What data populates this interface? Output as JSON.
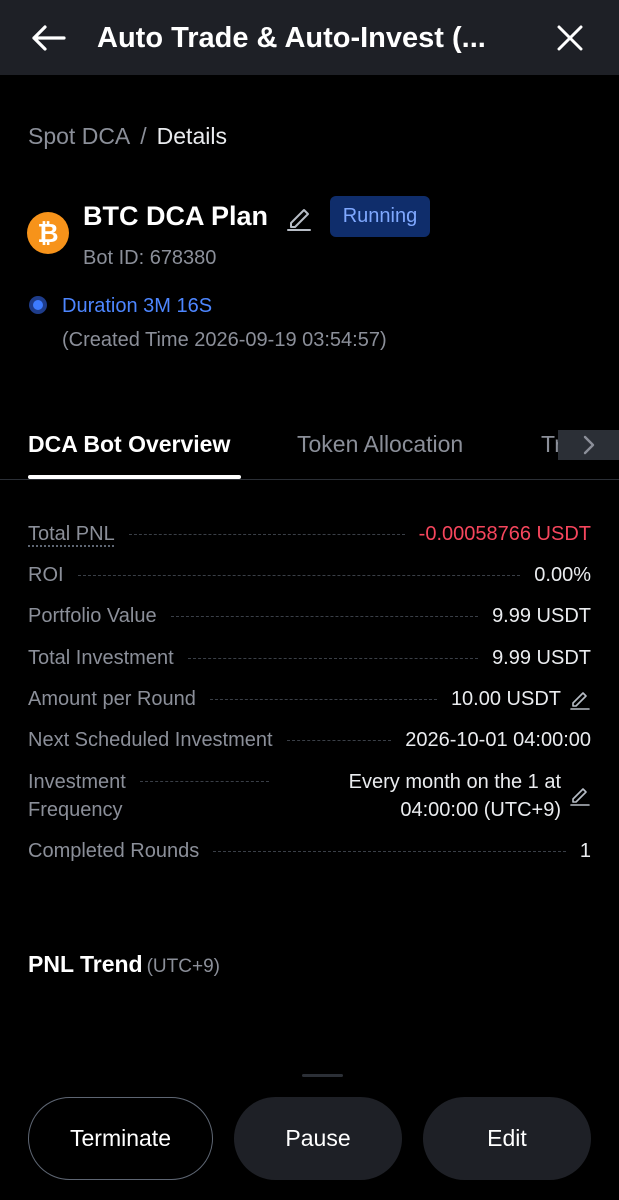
{
  "header": {
    "title": "Auto Trade & Auto-Invest (...",
    "back_icon": "arrow-left-icon",
    "close_icon": "close-icon"
  },
  "breadcrumb": {
    "parent": "Spot DCA",
    "separator": "/",
    "current": "Details"
  },
  "plan": {
    "name": "BTC DCA Plan",
    "status": "Running",
    "bot_id": "Bot ID: 678380",
    "duration": "Duration 3M 16S",
    "created": "(Created Time 2026-09-19 03:54:57)",
    "coin_logo": "bitcoin-icon",
    "coin_symbol": "₿"
  },
  "tabs": [
    {
      "label": "DCA Bot Overview",
      "active": true
    },
    {
      "label": "Token Allocation",
      "active": false
    },
    {
      "label": "Tr",
      "active": false
    }
  ],
  "overview": {
    "rows": [
      {
        "label": "Total PNL",
        "value": "-0.00058766 USDT"
      },
      {
        "label": "ROI",
        "value": "0.00%"
      },
      {
        "label": "Portfolio Value",
        "value": "9.99 USDT"
      },
      {
        "label": "Total Investment",
        "value": "9.99 USDT"
      },
      {
        "label": "Amount per Round",
        "value": "10.00 USDT"
      },
      {
        "label": "Next Scheduled Investment",
        "value": "2026-10-01 04:00:00"
      },
      {
        "label_line1": "Investment",
        "label_line2": "Frequency",
        "value_line1": "Every month on the 1 at",
        "value_line2": "04:00:00 (UTC+9)"
      },
      {
        "label": "Completed Rounds",
        "value": "1"
      }
    ]
  },
  "pnl_trend": {
    "title": "PNL Trend",
    "timezone": "(UTC+9)"
  },
  "actions": {
    "terminate": "Terminate",
    "pause": "Pause",
    "edit": "Edit"
  },
  "colors": {
    "background": "#000000",
    "header_bg": "#1e2026",
    "accent_blue": "#3d7bff",
    "negative": "#f6465d",
    "btc_orange": "#f7931a",
    "badge_bg": "#0f2d6b"
  }
}
